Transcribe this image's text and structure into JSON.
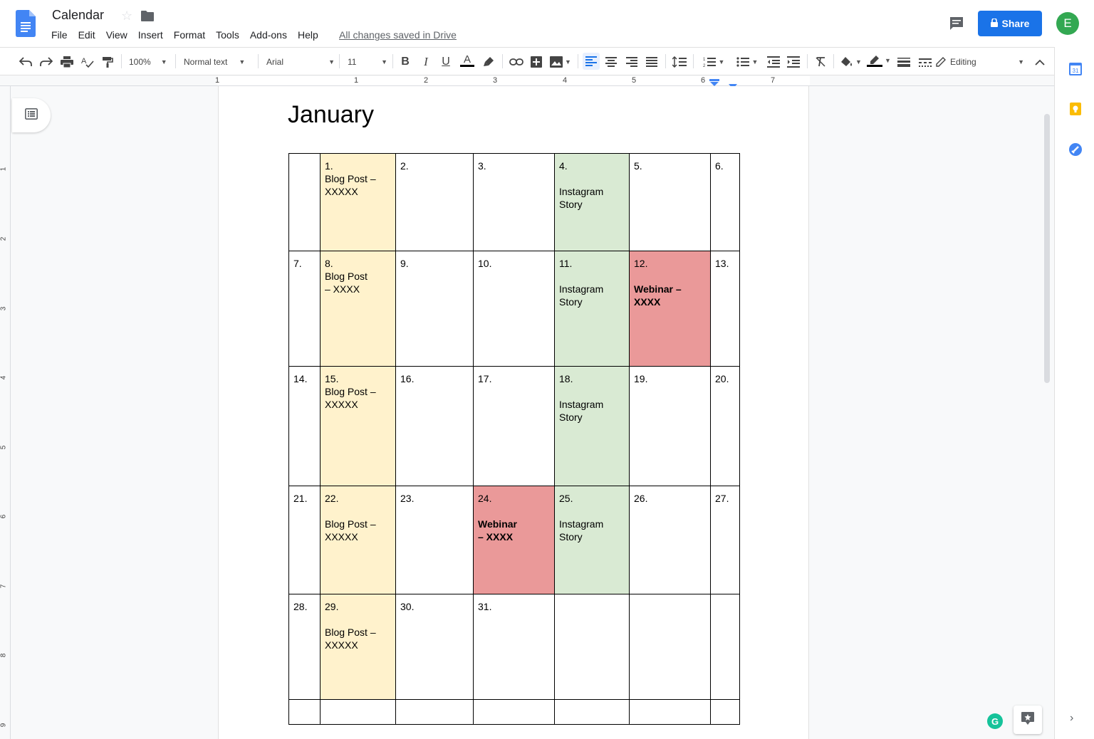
{
  "header": {
    "title": "Calendar",
    "menu": [
      "File",
      "Edit",
      "View",
      "Insert",
      "Format",
      "Tools",
      "Add-ons",
      "Help"
    ],
    "saved_status": "All changes saved in Drive",
    "share_label": "Share",
    "avatar_letter": "E"
  },
  "toolbar": {
    "zoom": "100%",
    "style": "Normal text",
    "font": "Arial",
    "font_size": "11",
    "mode": "Editing"
  },
  "ruler": {
    "numbers": [
      "1",
      "1",
      "2",
      "3",
      "4",
      "5",
      "6",
      "7"
    ]
  },
  "vruler": {
    "numbers": [
      "1",
      "2",
      "3",
      "4",
      "5",
      "6",
      "7",
      "8",
      "9"
    ]
  },
  "document": {
    "heading": "January",
    "rows": [
      [
        {
          "lines": [
            ""
          ],
          "color": "",
          "bold": false
        },
        {
          "lines": [
            "1.",
            "Blog Post  –",
            "XXXXX"
          ],
          "color": "yellow",
          "bold": false
        },
        {
          "lines": [
            "2."
          ],
          "color": "",
          "bold": false
        },
        {
          "lines": [
            "3."
          ],
          "color": "",
          "bold": false
        },
        {
          "lines": [
            "4.",
            "",
            "Instagram",
            "Story"
          ],
          "color": "green",
          "bold": false
        },
        {
          "lines": [
            "5."
          ],
          "color": "",
          "bold": false
        },
        {
          "lines": [
            "6."
          ],
          "color": "",
          "bold": false
        }
      ],
      [
        {
          "lines": [
            "7."
          ],
          "color": "",
          "bold": false
        },
        {
          "lines": [
            "8.",
            "Blog Post",
            "– XXXX"
          ],
          "color": "yellow",
          "bold": false
        },
        {
          "lines": [
            "9."
          ],
          "color": "",
          "bold": false
        },
        {
          "lines": [
            "10."
          ],
          "color": "",
          "bold": false
        },
        {
          "lines": [
            "11.",
            "",
            "Instagram",
            "Story"
          ],
          "color": "green",
          "bold": false
        },
        {
          "lines": [
            "12.",
            "",
            "Webinar –",
            "XXXX"
          ],
          "color": "red",
          "bold": true
        },
        {
          "lines": [
            "13."
          ],
          "color": "",
          "bold": false
        }
      ],
      [
        {
          "lines": [
            "14."
          ],
          "color": "",
          "bold": false
        },
        {
          "lines": [
            "15.",
            "Blog Post  –",
            "XXXXX"
          ],
          "color": "yellow",
          "bold": false
        },
        {
          "lines": [
            "16."
          ],
          "color": "",
          "bold": false
        },
        {
          "lines": [
            "17."
          ],
          "color": "",
          "bold": false
        },
        {
          "lines": [
            "18.",
            "",
            "Instagram",
            "Story"
          ],
          "color": "green",
          "bold": false
        },
        {
          "lines": [
            "19."
          ],
          "color": "",
          "bold": false
        },
        {
          "lines": [
            "20."
          ],
          "color": "",
          "bold": false
        }
      ],
      [
        {
          "lines": [
            "21."
          ],
          "color": "",
          "bold": false
        },
        {
          "lines": [
            "22.",
            "",
            "Blog Post  –",
            "XXXXX"
          ],
          "color": "yellow",
          "bold": false
        },
        {
          "lines": [
            "23."
          ],
          "color": "",
          "bold": false
        },
        {
          "lines": [
            "24.",
            "",
            "Webinar",
            "– XXXX"
          ],
          "color": "red",
          "bold": true
        },
        {
          "lines": [
            "25.",
            "",
            "Instagram",
            "Story"
          ],
          "color": "green",
          "bold": false
        },
        {
          "lines": [
            "26."
          ],
          "color": "",
          "bold": false
        },
        {
          "lines": [
            "27."
          ],
          "color": "",
          "bold": false
        }
      ],
      [
        {
          "lines": [
            "28."
          ],
          "color": "",
          "bold": false
        },
        {
          "lines": [
            "29.",
            "",
            "Blog Post  –",
            "XXXXX"
          ],
          "color": "yellow",
          "bold": false
        },
        {
          "lines": [
            "30."
          ],
          "color": "",
          "bold": false
        },
        {
          "lines": [
            "31."
          ],
          "color": "",
          "bold": false
        },
        {
          "lines": [
            ""
          ],
          "color": "",
          "bold": false
        },
        {
          "lines": [
            ""
          ],
          "color": "",
          "bold": false
        },
        {
          "lines": [
            ""
          ],
          "color": "",
          "bold": false
        }
      ],
      [
        {
          "lines": [
            ""
          ],
          "color": "",
          "bold": false
        },
        {
          "lines": [
            ""
          ],
          "color": "",
          "bold": false
        },
        {
          "lines": [
            ""
          ],
          "color": "",
          "bold": false
        },
        {
          "lines": [
            ""
          ],
          "color": "",
          "bold": false
        },
        {
          "lines": [
            ""
          ],
          "color": "",
          "bold": false
        },
        {
          "lines": [
            ""
          ],
          "color": "",
          "bold": false
        },
        {
          "lines": [
            ""
          ],
          "color": "",
          "bold": false
        }
      ]
    ]
  },
  "side": {
    "calendar_day": "31"
  },
  "grammarly_letter": "G",
  "colors": {
    "accent": "#1a73e8",
    "yellow": "#fff2cc",
    "green": "#d9ead3",
    "red": "#ea9999",
    "avatar": "#33a852"
  }
}
